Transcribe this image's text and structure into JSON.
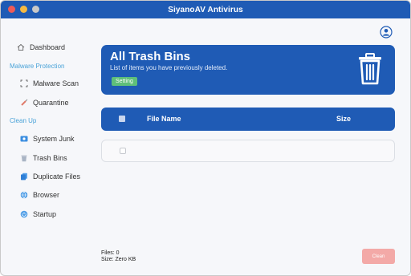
{
  "window": {
    "title": "SiyanoAV Antivirus"
  },
  "sidebar": {
    "dashboard": "Dashboard",
    "section_malware": "Malware Protection",
    "malware_scan": "Malware Scan",
    "quarantine": "Quarantine",
    "section_cleanup": "Clean Up",
    "system_junk": "System Junk",
    "trash_bins": "Trash Bins",
    "duplicate_files": "Duplicate Files",
    "browser": "Browser",
    "startup": "Startup"
  },
  "banner": {
    "title": "All Trash Bins",
    "subtitle": "List of items you have previously deleted.",
    "setting_label": "Setting"
  },
  "table": {
    "col_name": "File Name",
    "col_size": "Size"
  },
  "footer": {
    "files": "Files: 0",
    "size": "Size: Zero KB",
    "clean_label": "Clean"
  },
  "colors": {
    "accent": "#1f5bb5",
    "section": "#4aa3d8",
    "setting": "#5fbf7a",
    "clean_disabled": "#f3a9a7"
  }
}
